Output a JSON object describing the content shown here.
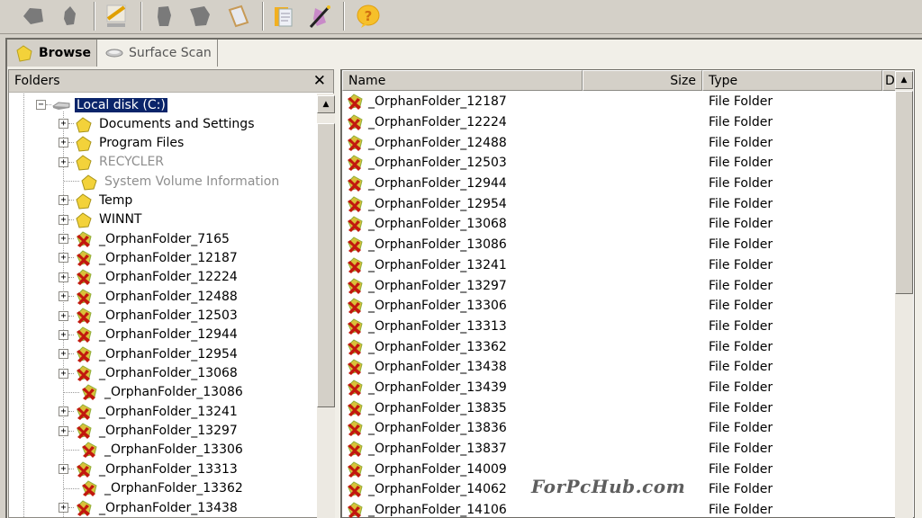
{
  "toolbar": {
    "buttons": [
      {
        "name": "back",
        "icon": "back-arrow-icon"
      },
      {
        "name": "up",
        "icon": "up-arrow-icon"
      },
      {
        "name": "scan",
        "icon": "scan-disk-icon"
      },
      {
        "name": "copy",
        "icon": "copy-icon"
      },
      {
        "name": "move",
        "icon": "move-icon"
      },
      {
        "name": "properties",
        "icon": "properties-icon"
      },
      {
        "name": "log",
        "icon": "notepad-icon"
      },
      {
        "name": "settings",
        "icon": "wizard-icon"
      },
      {
        "name": "help",
        "icon": "help-icon"
      }
    ]
  },
  "tabs": [
    {
      "label": "Browse",
      "icon": "folder-icon",
      "active": true
    },
    {
      "label": "Surface Scan",
      "icon": "disk-icon",
      "active": false
    }
  ],
  "folders_pane": {
    "title": "Folders",
    "close_label": "✕",
    "root": {
      "label": "Local disk (C:)",
      "expanded": true,
      "selected": true
    },
    "items": [
      {
        "label": "Documents and Settings",
        "kind": "normal",
        "expandable": true
      },
      {
        "label": "Program Files",
        "kind": "normal",
        "expandable": true
      },
      {
        "label": "RECYCLER",
        "kind": "hidden",
        "expandable": true
      },
      {
        "label": "System Volume Information",
        "kind": "hidden",
        "expandable": false
      },
      {
        "label": "Temp",
        "kind": "normal",
        "expandable": true
      },
      {
        "label": "WINNT",
        "kind": "normal",
        "expandable": true
      },
      {
        "label": "_OrphanFolder_7165",
        "kind": "orphan",
        "expandable": true
      },
      {
        "label": "_OrphanFolder_12187",
        "kind": "orphan",
        "expandable": true
      },
      {
        "label": "_OrphanFolder_12224",
        "kind": "orphan",
        "expandable": true
      },
      {
        "label": "_OrphanFolder_12488",
        "kind": "orphan",
        "expandable": true
      },
      {
        "label": "_OrphanFolder_12503",
        "kind": "orphan",
        "expandable": true
      },
      {
        "label": "_OrphanFolder_12944",
        "kind": "orphan",
        "expandable": true
      },
      {
        "label": "_OrphanFolder_12954",
        "kind": "orphan",
        "expandable": true
      },
      {
        "label": "_OrphanFolder_13068",
        "kind": "orphan",
        "expandable": true
      },
      {
        "label": "_OrphanFolder_13086",
        "kind": "orphan",
        "expandable": false
      },
      {
        "label": "_OrphanFolder_13241",
        "kind": "orphan",
        "expandable": true
      },
      {
        "label": "_OrphanFolder_13297",
        "kind": "orphan",
        "expandable": true
      },
      {
        "label": "_OrphanFolder_13306",
        "kind": "orphan",
        "expandable": false
      },
      {
        "label": "_OrphanFolder_13313",
        "kind": "orphan",
        "expandable": true
      },
      {
        "label": "_OrphanFolder_13362",
        "kind": "orphan",
        "expandable": false
      },
      {
        "label": "_OrphanFolder_13438",
        "kind": "orphan",
        "expandable": true
      }
    ]
  },
  "list_pane": {
    "columns": {
      "name": "Name",
      "size": "Size",
      "type": "Type",
      "date": "D"
    },
    "rows": [
      {
        "name": "_OrphanFolder_12187",
        "size": "",
        "type": "File Folder"
      },
      {
        "name": "_OrphanFolder_12224",
        "size": "",
        "type": "File Folder"
      },
      {
        "name": "_OrphanFolder_12488",
        "size": "",
        "type": "File Folder"
      },
      {
        "name": "_OrphanFolder_12503",
        "size": "",
        "type": "File Folder"
      },
      {
        "name": "_OrphanFolder_12944",
        "size": "",
        "type": "File Folder"
      },
      {
        "name": "_OrphanFolder_12954",
        "size": "",
        "type": "File Folder"
      },
      {
        "name": "_OrphanFolder_13068",
        "size": "",
        "type": "File Folder"
      },
      {
        "name": "_OrphanFolder_13086",
        "size": "",
        "type": "File Folder"
      },
      {
        "name": "_OrphanFolder_13241",
        "size": "",
        "type": "File Folder"
      },
      {
        "name": "_OrphanFolder_13297",
        "size": "",
        "type": "File Folder"
      },
      {
        "name": "_OrphanFolder_13306",
        "size": "",
        "type": "File Folder"
      },
      {
        "name": "_OrphanFolder_13313",
        "size": "",
        "type": "File Folder"
      },
      {
        "name": "_OrphanFolder_13362",
        "size": "",
        "type": "File Folder"
      },
      {
        "name": "_OrphanFolder_13438",
        "size": "",
        "type": "File Folder"
      },
      {
        "name": "_OrphanFolder_13439",
        "size": "",
        "type": "File Folder"
      },
      {
        "name": "_OrphanFolder_13835",
        "size": "",
        "type": "File Folder"
      },
      {
        "name": "_OrphanFolder_13836",
        "size": "",
        "type": "File Folder"
      },
      {
        "name": "_OrphanFolder_13837",
        "size": "",
        "type": "File Folder"
      },
      {
        "name": "_OrphanFolder_14009",
        "size": "",
        "type": "File Folder"
      },
      {
        "name": "_OrphanFolder_14062",
        "size": "",
        "type": "File Folder"
      },
      {
        "name": "_OrphanFolder_14106",
        "size": "",
        "type": "File Folder"
      }
    ]
  },
  "watermark": "ForPcHub.com",
  "colors": {
    "selection": "#0a246a",
    "chrome": "#d4d0c8",
    "hidden_text": "#8e8e8e"
  }
}
